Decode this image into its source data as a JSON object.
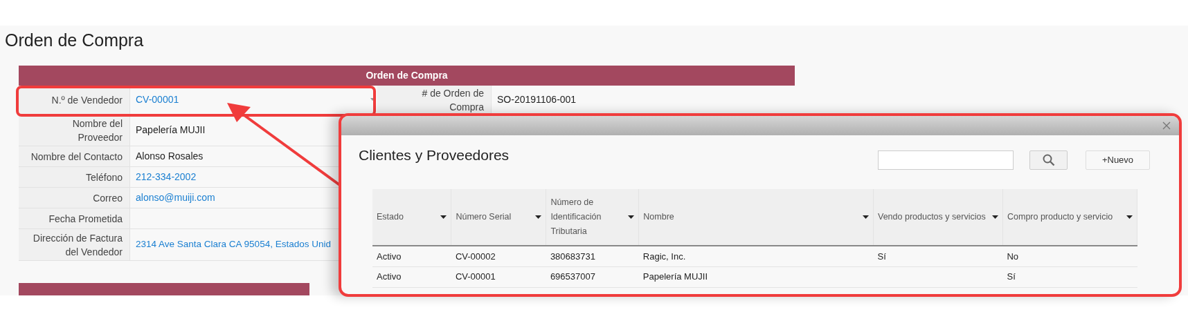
{
  "page": {
    "title": "Orden de Compra"
  },
  "form": {
    "header": "Orden de Compra",
    "first_row": [
      {
        "label": "N.º de Vendedor",
        "value": "CV-00001",
        "kind": "select-link"
      },
      {
        "label": "# de Orden de Compra",
        "value": "SO-20191106-001",
        "kind": "text"
      }
    ],
    "fields": [
      {
        "label": "Nombre del Proveedor",
        "value": "Papelería MUJII",
        "kind": "text"
      },
      {
        "label": "Nombre del Contacto",
        "value": "Alonso Rosales",
        "kind": "text"
      },
      {
        "label": "Teléfono",
        "value": "212-334-2002",
        "kind": "link"
      },
      {
        "label": "Correo",
        "value": "alonso@muiji.com",
        "kind": "link"
      },
      {
        "label": "Fecha Prometida",
        "kind": "text"
      },
      {
        "label": "Dirección de Factura del Vendedor",
        "value": "2314 Ave Santa Clara CA 95054, Estados Unid",
        "kind": "link"
      }
    ]
  },
  "dialog": {
    "title": "Clientes y Proveedores",
    "new_button": "+Nuevo",
    "table": {
      "columns": [
        {
          "label": "Estado",
          "sortable": true
        },
        {
          "label": "Número Serial",
          "sortable": true
        },
        {
          "label": "Número de Identificación Tributaria",
          "sortable": true
        },
        {
          "label": "Nombre",
          "sortable": true
        },
        {
          "label": "Vendo productos y servicios",
          "sortable": true
        },
        {
          "label": "Compro producto y servicio",
          "sortable": true
        }
      ],
      "rows": [
        [
          "Activo",
          "CV-00002",
          "380683731",
          "Ragic, Inc.",
          "Sí",
          "No"
        ],
        [
          "Activo",
          "CV-00001",
          "696537007",
          "Papelería MUJII",
          null,
          "Sí"
        ]
      ]
    }
  }
}
